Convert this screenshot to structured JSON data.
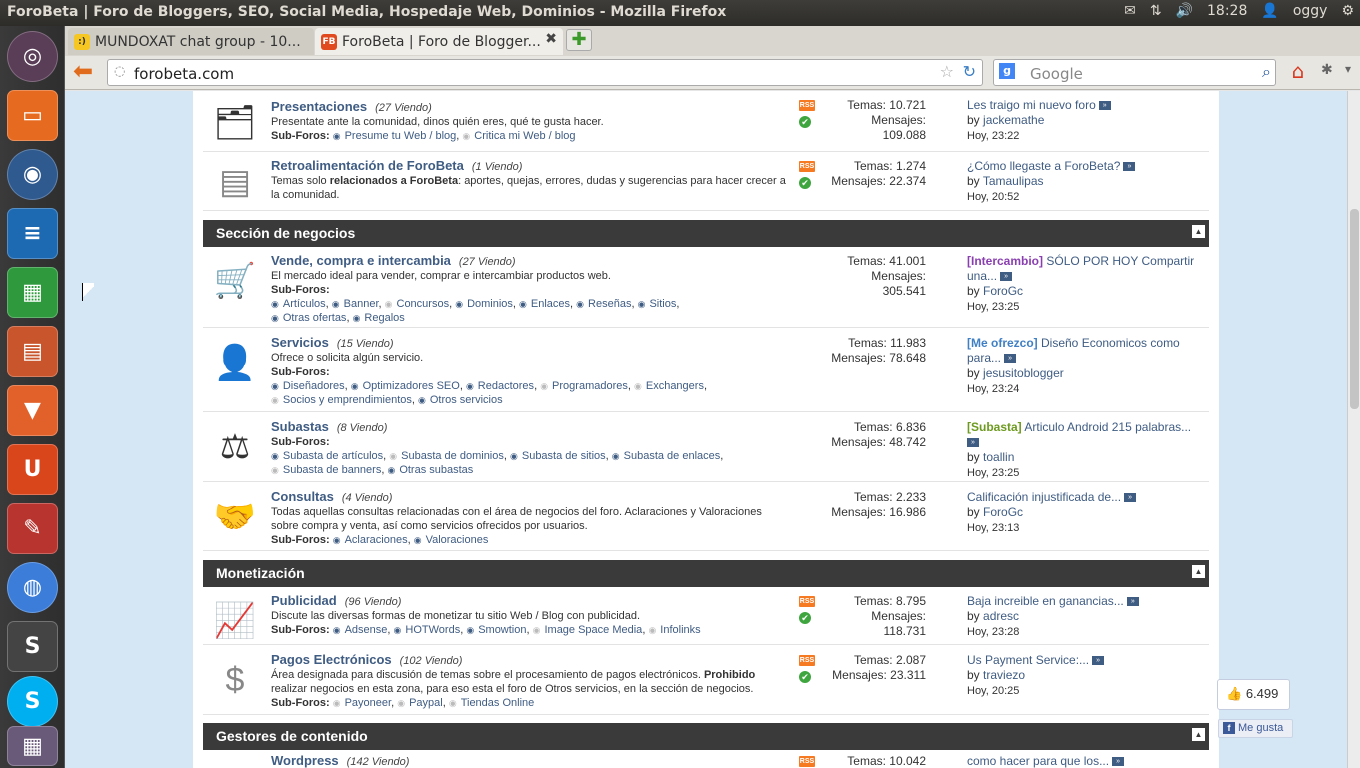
{
  "window": {
    "title": "ForoBeta | Foro de Bloggers, SEO, Social Media, Hospedaje Web, Dominios - Mozilla Firefox"
  },
  "tray": {
    "time": "18:28",
    "user": "oggy"
  },
  "tabs": [
    {
      "label": "MUNDOXAT chat group - 10...",
      "fav": ":)"
    },
    {
      "label": "ForoBeta | Foro de Blogger...",
      "fav": "FB"
    }
  ],
  "nav": {
    "url": "forobeta.com",
    "search_placeholder": "Google"
  },
  "sections": [
    {
      "title": "Sección de negocios"
    },
    {
      "title": "Monetización"
    },
    {
      "title": "Gestores de contenido"
    }
  ],
  "forums": [
    {
      "name": "Presentaciones",
      "viewing": "(27 Viendo)",
      "desc": "Presentate ante la comunidad, dinos quién eres, qué te gusta hacer.",
      "subs_label": "Sub-Foros:",
      "subs": [
        "Presume tu Web / blog",
        "Critica mi Web / blog"
      ],
      "temas": "Temas: 10.721",
      "mensajes_label": "Mensajes:",
      "mensajes": "109.088",
      "last_prefix": "",
      "last_title": "Les traigo mi nuevo foro",
      "by": "by",
      "author": "jackemathe",
      "time": "Hoy, 23:22"
    },
    {
      "name": "Retroalimentación de ForoBeta",
      "viewing": "(1 Viendo)",
      "desc_a": "Temas solo ",
      "desc_b": "relacionados a ForoBeta",
      "desc_c": ": aportes, quejas, errores, dudas y sugerencias para hacer crecer a la comunidad.",
      "temas": "Temas: 1.274",
      "mensajes": "Mensajes: 22.374",
      "last_title": "¿Cómo llegaste a ForoBeta?",
      "by": "by",
      "author": "Tamaulipas",
      "time": "Hoy, 20:52"
    },
    {
      "name": "Vende, compra e intercambia",
      "viewing": "(27 Viendo)",
      "desc": "El mercado ideal para vender, comprar e intercambiar productos web.",
      "subs_label": "Sub-Foros:",
      "subs": [
        "Artículos",
        "Banner",
        "Concursos",
        "Dominios",
        "Enlaces",
        "Reseñas",
        "Sitios",
        "Otras ofertas",
        "Regalos"
      ],
      "temas": "Temas: 41.001",
      "mensajes_label": "Mensajes:",
      "mensajes": "305.541",
      "last_prefix": "[Intercambio]",
      "last_title": " SÓLO POR HOY Compartir una...",
      "by": "by",
      "author": "ForoGc",
      "time": "Hoy, 23:25"
    },
    {
      "name": "Servicios",
      "viewing": "(15 Viendo)",
      "desc": "Ofrece o solicita algún servicio.",
      "subs_label": "Sub-Foros:",
      "subs": [
        "Diseñadores",
        "Optimizadores SEO",
        "Redactores",
        "Programadores",
        "Exchangers",
        "Socios y emprendimientos",
        "Otros servicios"
      ],
      "temas": "Temas: 11.983",
      "mensajes": "Mensajes: 78.648",
      "last_prefix": "[Me ofrezco]",
      "last_title": " Diseño Economicos como para...",
      "by": "by",
      "author": "jesusitoblogger",
      "time": "Hoy, 23:24"
    },
    {
      "name": "Subastas",
      "viewing": "(8 Viendo)",
      "subs_label": "Sub-Foros:",
      "subs": [
        "Subasta de artículos",
        "Subasta de dominios",
        "Subasta de sitios",
        "Subasta de enlaces",
        "Subasta de banners",
        "Otras subastas"
      ],
      "temas": "Temas: 6.836",
      "mensajes": "Mensajes: 48.742",
      "last_prefix": "[Subasta]",
      "last_title": " Articulo Android 215 palabras...",
      "by": "by",
      "author": "toallin",
      "time": "Hoy, 23:25"
    },
    {
      "name": "Consultas",
      "viewing": "(4 Viendo)",
      "desc": "Todas aquellas consultas relacionadas con el área de negocios del foro. Aclaraciones y Valoraciones sobre compra y venta, así como servicios ofrecidos por usuarios.",
      "subs_label": "Sub-Foros:",
      "subs": [
        "Aclaraciones",
        "Valoraciones"
      ],
      "temas": "Temas: 2.233",
      "mensajes": "Mensajes: 16.986",
      "last_title": "Calificación injustificada de...",
      "by": "by",
      "author": "ForoGc",
      "time": "Hoy, 23:13"
    },
    {
      "name": "Publicidad",
      "viewing": "(96 Viendo)",
      "desc": "Discute las diversas formas de monetizar tu sitio Web / Blog con publicidad.",
      "subs_label": "Sub-Foros:",
      "subs": [
        "Adsense",
        "HOTWords",
        "Smowtion",
        "Image Space Media",
        "Infolinks"
      ],
      "temas": "Temas: 8.795",
      "mensajes_label": "Mensajes:",
      "mensajes": "118.731",
      "last_title": "Baja increible en ganancias...",
      "by": "by",
      "author": "adresc",
      "time": "Hoy, 23:28"
    },
    {
      "name": "Pagos Electrónicos",
      "viewing": "(102 Viendo)",
      "desc_a": "Área designada para discusión de temas sobre el procesamiento de pagos electrónicos. ",
      "desc_b": "Prohibido",
      "desc_c": " realizar negocios en esta zona, para eso esta el foro de Otros servicios, en la sección de negocios.",
      "subs_label": "Sub-Foros:",
      "subs": [
        "Payoneer",
        "Paypal",
        "Tiendas Online"
      ],
      "temas": "Temas: 2.087",
      "mensajes": "Mensajes: 23.311",
      "last_title": "Us Payment Service:...",
      "by": "by",
      "author": "traviezo",
      "time": "Hoy, 20:25"
    },
    {
      "name": "Wordpress",
      "viewing": "(142 Viendo)",
      "temas": "Temas: 10.042",
      "last_title": "como hacer para que los..."
    }
  ],
  "rss_label": "RSS",
  "like": {
    "count": "6.499",
    "button": "Me gusta",
    "fb": "f"
  }
}
